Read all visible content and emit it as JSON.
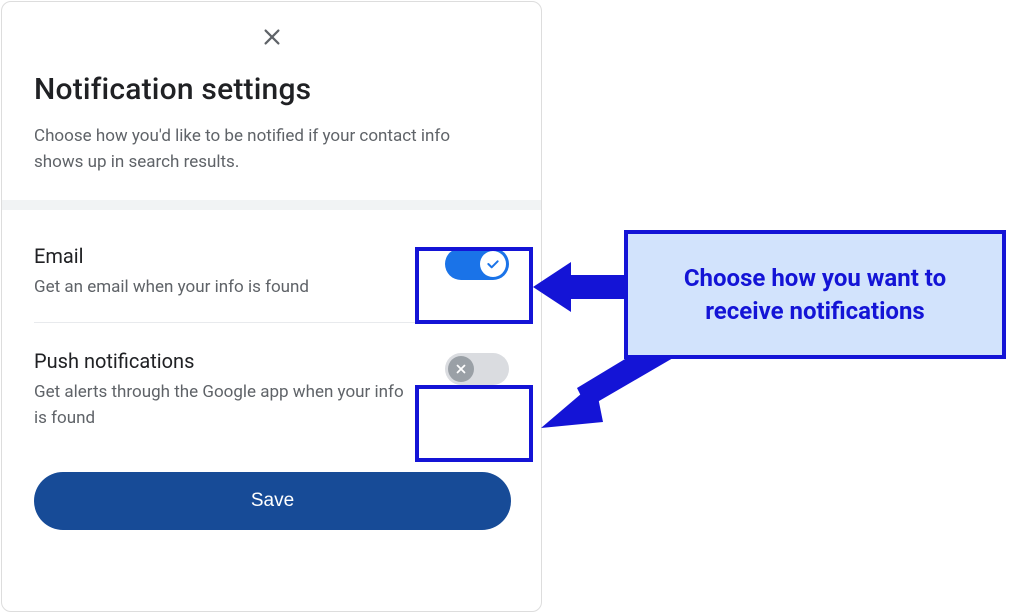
{
  "modal": {
    "title": "Notification settings",
    "subtitle": "Choose how you'd like to be notified if your contact info shows up in search results.",
    "options": [
      {
        "title": "Email",
        "description": "Get an email when your info is found",
        "enabled": true
      },
      {
        "title": "Push notifications",
        "description": "Get alerts through the Google app when your info is found",
        "enabled": false
      }
    ],
    "save_label": "Save"
  },
  "annotation": {
    "callout": "Choose how you want to receive notifications"
  },
  "colors": {
    "primary_blue": "#1a73e8",
    "save_blue": "#174b97",
    "annotation_blue": "#1414d6",
    "callout_bg": "#d2e3fc",
    "text_primary": "#202124",
    "text_secondary": "#5f6368"
  }
}
